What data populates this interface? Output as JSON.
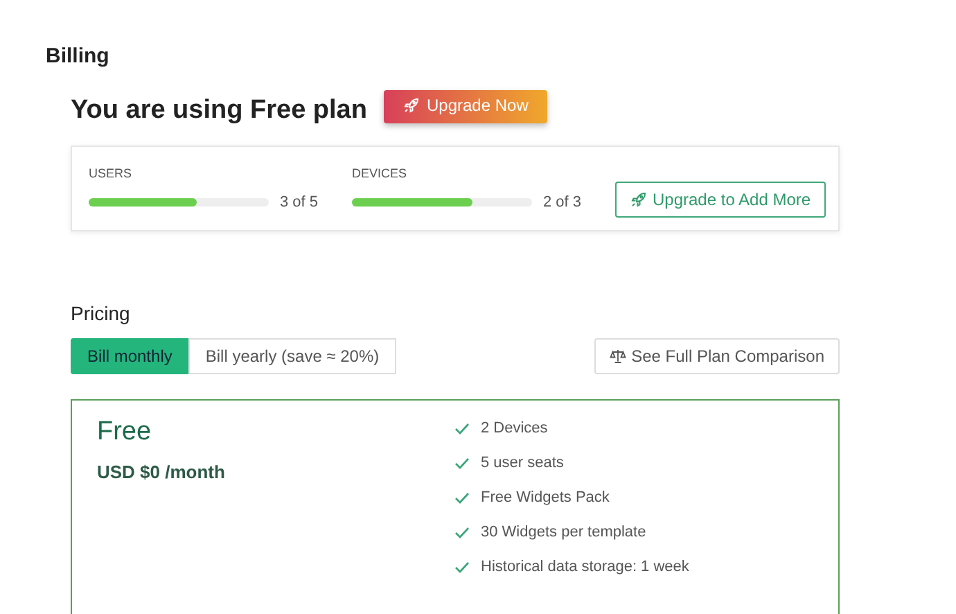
{
  "page_title": "Billing",
  "plan_heading": "You are using Free plan",
  "upgrade_button": "Upgrade Now",
  "usage": [
    {
      "label": "USERS",
      "level": 0.6,
      "reading": "3 of 5"
    },
    {
      "label": "DEVICES",
      "level": 0.667,
      "reading": "2 of 3"
    }
  ],
  "add_more_button": "Upgrade to Add More",
  "pricing": {
    "title": "Pricing",
    "billing_options": [
      {
        "label": "Bill monthly",
        "selected": true
      },
      {
        "label": "Bill yearly (save ≈ 20%)",
        "selected": false
      }
    ],
    "comparison_button": "See Full Plan Comparison",
    "plan": {
      "name": "Free",
      "price": "USD $0 /month",
      "features": [
        "2 Devices",
        "5 user seats",
        "Free Widgets Pack",
        "30 Widgets per template",
        "Historical data storage: 1 week"
      ]
    }
  }
}
